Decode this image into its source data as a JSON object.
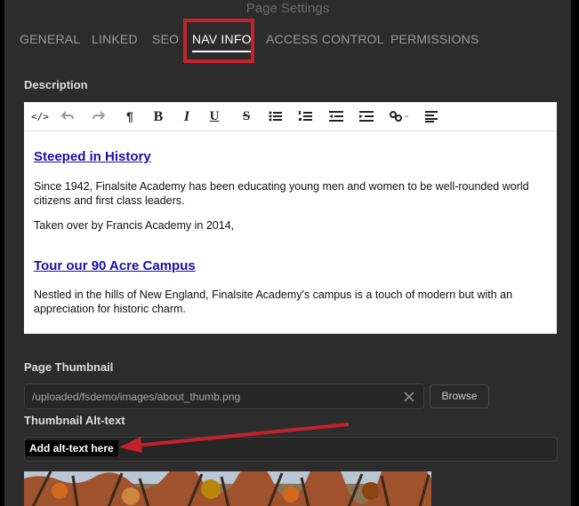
{
  "dialog": {
    "title": "Page Settings"
  },
  "tabs": [
    {
      "label": "GENERAL",
      "active": false
    },
    {
      "label": "LINKED",
      "active": false
    },
    {
      "label": "SEO",
      "active": false
    },
    {
      "label": "NAV INFO",
      "active": true
    },
    {
      "label": "ACCESS CONTROL",
      "active": false
    },
    {
      "label": "PERMISSIONS",
      "active": false
    }
  ],
  "description": {
    "label": "Description",
    "toolbar": {
      "source_glyph": "</>",
      "paragraph_glyph": "¶",
      "bold_glyph": "B",
      "italic_glyph": "I",
      "underline_glyph": "U",
      "strike_glyph": "S"
    },
    "content": {
      "heading1": "Steeped in History",
      "para1": "Since 1942, Finalsite Academy has been educating young men and women to be well-rounded world citizens and first class leaders.",
      "para2": "Taken over by Francis Academy in 2014,",
      "heading2": "Tour our 90 Acre Campus",
      "para3": "Nestled in the hills of New England, Finalsite Academy's campus is a touch of modern but with an appreciation for historic charm."
    }
  },
  "thumbnail": {
    "label": "Page Thumbnail",
    "value": "/uploaded/fsdemo/images/about_thumb.png",
    "browse_label": "Browse"
  },
  "alt_text": {
    "label": "Thumbnail Alt-text",
    "annotation": "Add alt-text here"
  },
  "colors": {
    "highlight": "#c4212e",
    "link": "#1a0dab",
    "background": "#2c2c2c"
  }
}
